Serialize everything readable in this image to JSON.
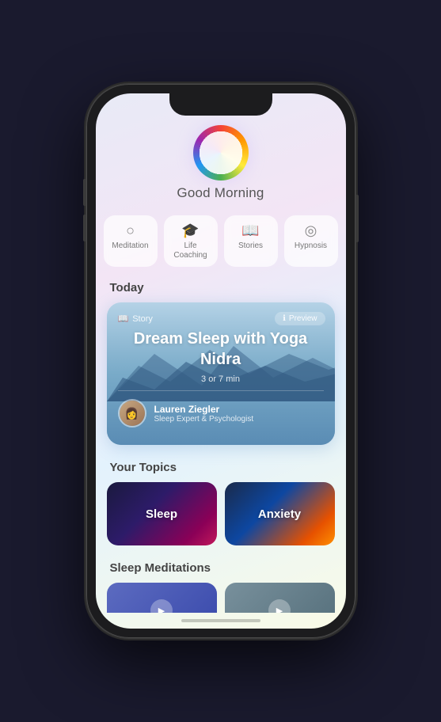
{
  "greeting": "Good Morning",
  "rainbow_circle": {
    "alt": "rainbow circle icon"
  },
  "categories": [
    {
      "id": "meditation",
      "label": "Meditation",
      "icon": "○"
    },
    {
      "id": "life-coaching",
      "label": "Life Coaching",
      "icon": "🎓"
    },
    {
      "id": "stories",
      "label": "Stories",
      "icon": "📖"
    },
    {
      "id": "hypnosis",
      "label": "Hypnosis",
      "icon": "◎"
    }
  ],
  "today_section": {
    "heading": "Today",
    "card": {
      "preview_icon": "ℹ",
      "preview_label": "Preview",
      "story_icon": "📖",
      "story_label": "Story",
      "title": "Dream Sleep with Yoga Nidra",
      "duration": "3 or 7 min",
      "author_name": "Lauren Ziegler",
      "author_title": "Sleep Expert & Psychologist"
    }
  },
  "topics_section": {
    "heading": "Your Topics",
    "topics": [
      {
        "id": "sleep",
        "label": "Sleep"
      },
      {
        "id": "anxiety",
        "label": "Anxiety"
      }
    ]
  },
  "sleep_meditations": {
    "heading": "Sleep Meditations"
  }
}
